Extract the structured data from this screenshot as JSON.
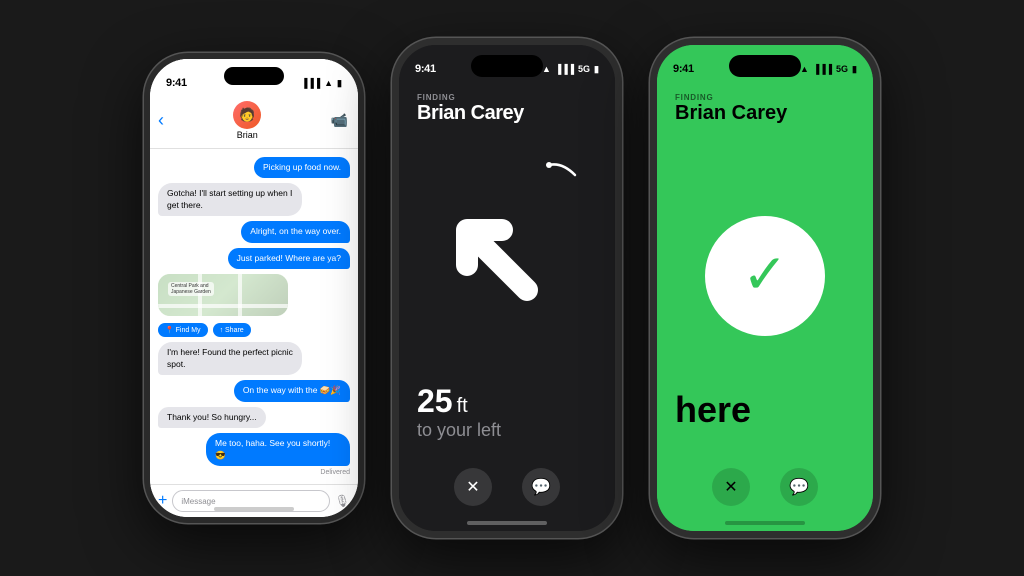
{
  "background": "#1a1a1a",
  "phones": {
    "left": {
      "status_time": "9:41",
      "contact_name": "Brian",
      "messages": [
        {
          "type": "out",
          "text": "Picking up food now."
        },
        {
          "type": "in",
          "text": "Gotcha! I'll start setting up when I get there."
        },
        {
          "type": "out",
          "text": "Alright, on the way over."
        },
        {
          "type": "out",
          "text": "Just parked! Where are ya?"
        },
        {
          "type": "map",
          "text": ""
        },
        {
          "type": "in",
          "text": "I'm here! Found the perfect picnic spot."
        },
        {
          "type": "out",
          "text": "On the way with the 🥪🎉"
        },
        {
          "type": "in",
          "text": "Thank you! So hungry..."
        },
        {
          "type": "out",
          "text": "Me too, haha. See you shortly! 😎"
        }
      ],
      "delivered": "Delivered",
      "input_placeholder": "iMessage"
    },
    "center": {
      "status_time": "9:41",
      "finding_label": "FINDING",
      "person_name": "Brian Carey",
      "distance": "25",
      "unit": "ft",
      "direction_line1": "to your left",
      "btn_cancel": "✕",
      "btn_message": "💬"
    },
    "right": {
      "status_time": "9:41",
      "finding_label": "FINDING",
      "person_name": "Brian Carey",
      "here_text": "here",
      "btn_cancel": "✕",
      "btn_message": "💬"
    }
  }
}
